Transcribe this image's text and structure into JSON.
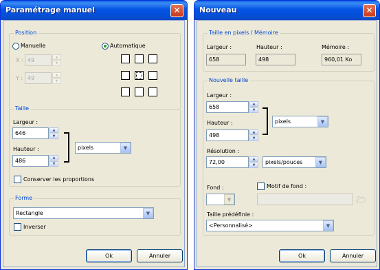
{
  "dialog1": {
    "title": "Paramétrage manuel",
    "close_glyph": "✕",
    "position": {
      "title": "Position",
      "manual_label": "Manuelle",
      "auto_label": "Automatique",
      "x_label": "X :",
      "x_value": "49",
      "y_label": "Y :",
      "y_value": "49"
    },
    "size": {
      "title": "Taille",
      "width_label": "Largeur :",
      "width_value": "646",
      "height_label": "Hauteur :",
      "height_value": "486",
      "unit_value": "pixels",
      "keep_ratio_label": "Conserver les proportions"
    },
    "shape": {
      "title": "Forme",
      "shape_value": "Rectangle",
      "invert_label": "Inverser"
    },
    "ok_label": "Ok",
    "cancel_label": "Annuler"
  },
  "dialog2": {
    "title": "Nouveau",
    "close_glyph": "✕",
    "current": {
      "title": "Taille en pixels / Mémoire",
      "width_label": "Largeur :",
      "width_value": "658",
      "height_label": "Hauteur :",
      "height_value": "498",
      "memory_label": "Mémoire :",
      "memory_value": "960,01 Ko"
    },
    "new_size": {
      "title": "Nouvelle taille",
      "width_label": "Largeur :",
      "width_value": "658",
      "height_label": "Hauteur :",
      "height_value": "498",
      "unit_value": "pixels",
      "resolution_label": "Résolution :",
      "resolution_value": "72,00",
      "resolution_unit": "pixels/pouces",
      "background_label": "Fond :",
      "pattern_label": "Motif de fond :",
      "preset_label": "Taille prédéfinie :",
      "preset_value": "<Personnalisé>"
    },
    "ok_label": "Ok",
    "cancel_label": "Annuler"
  },
  "icons": {
    "spin_up": "▲",
    "spin_down": "▼",
    "dropdown": "▼",
    "folder": "🗁"
  }
}
